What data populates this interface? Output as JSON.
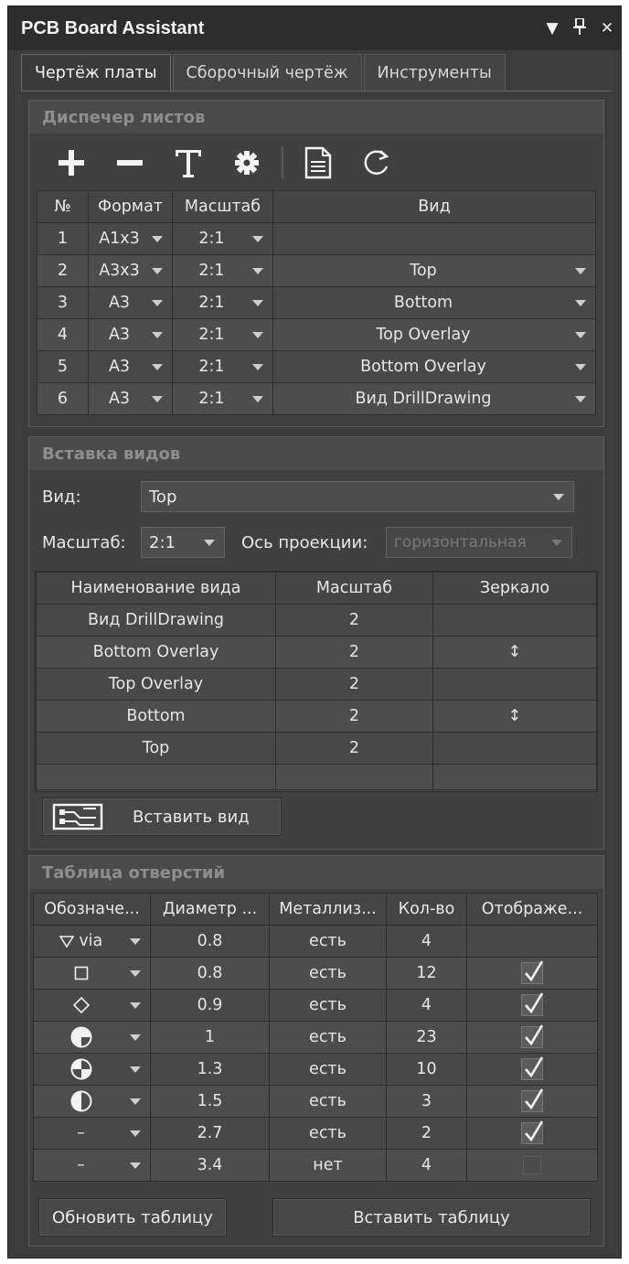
{
  "window": {
    "title": "PCB Board Assistant"
  },
  "tabs": [
    {
      "label": "Чертёж платы",
      "active": true
    },
    {
      "label": "Сборочный чертёж",
      "active": false
    },
    {
      "label": "Инструменты",
      "active": false
    }
  ],
  "sheet_manager": {
    "title": "Диспечер листов",
    "toolbar": [
      "add-icon",
      "remove-icon",
      "text-icon",
      "gear-icon",
      "document-icon",
      "refresh-icon"
    ],
    "headers": {
      "num": "№",
      "format": "Формат",
      "scale": "Масштаб",
      "view": "Вид"
    },
    "rows": [
      {
        "num": "1",
        "format": "А1х3",
        "scale": "2:1",
        "view": ""
      },
      {
        "num": "2",
        "format": "А3х3",
        "scale": "2:1",
        "view": "Top"
      },
      {
        "num": "3",
        "format": "А3",
        "scale": "2:1",
        "view": "Bottom"
      },
      {
        "num": "4",
        "format": "А3",
        "scale": "2:1",
        "view": "Top Overlay"
      },
      {
        "num": "5",
        "format": "А3",
        "scale": "2:1",
        "view": "Bottom Overlay"
      },
      {
        "num": "6",
        "format": "А3",
        "scale": "2:1",
        "view": "Вид DrillDrawing"
      }
    ]
  },
  "insert_views": {
    "title": "Вставка видов",
    "view_label": "Вид:",
    "view_value": "Top",
    "scale_label": "Масштаб:",
    "scale_value": "2:1",
    "axis_label": "Ось проекции:",
    "axis_value": "горизонтальная",
    "headers": {
      "name": "Наименование вида",
      "scale": "Масштаб",
      "mirror": "Зеркало"
    },
    "rows": [
      {
        "name": "Вид DrillDrawing",
        "scale": "2",
        "mirror": ""
      },
      {
        "name": "Bottom Overlay",
        "scale": "2",
        "mirror": "↕"
      },
      {
        "name": "Top Overlay",
        "scale": "2",
        "mirror": ""
      },
      {
        "name": "Bottom",
        "scale": "2",
        "mirror": "↕"
      },
      {
        "name": "Top",
        "scale": "2",
        "mirror": ""
      }
    ],
    "insert_button": "Вставить вид"
  },
  "holes_table": {
    "title": "Таблица отверстий",
    "headers": {
      "symbol": "Обозначе...",
      "diameter": "Диаметр ...",
      "plating": "Металлиз...",
      "count": "Кол-во",
      "display": "Отображе..."
    },
    "rows": [
      {
        "symbol": "via",
        "symbol_icon": "triangle-down-icon",
        "diameter": "0.8",
        "plating": "есть",
        "count": "4",
        "display": "none"
      },
      {
        "symbol": "",
        "symbol_icon": "square-icon",
        "diameter": "0.8",
        "plating": "есть",
        "count": "12",
        "display": "checked"
      },
      {
        "symbol": "",
        "symbol_icon": "diamond-icon",
        "diameter": "0.9",
        "plating": "есть",
        "count": "4",
        "display": "checked"
      },
      {
        "symbol": "",
        "symbol_icon": "quarter-circle-icon",
        "diameter": "1",
        "plating": "есть",
        "count": "23",
        "display": "checked"
      },
      {
        "symbol": "",
        "symbol_icon": "cross-circle-icon",
        "diameter": "1.3",
        "plating": "есть",
        "count": "10",
        "display": "checked"
      },
      {
        "symbol": "",
        "symbol_icon": "half-circle-icon",
        "diameter": "1.5",
        "plating": "есть",
        "count": "3",
        "display": "checked"
      },
      {
        "symbol": "–",
        "symbol_icon": "dash-icon",
        "diameter": "2.7",
        "plating": "есть",
        "count": "2",
        "display": "checked"
      },
      {
        "symbol": "–",
        "symbol_icon": "dash-icon",
        "diameter": "3.4",
        "plating": "нет",
        "count": "4",
        "display": "unchecked"
      }
    ],
    "update_button": "Обновить таблицу",
    "insert_button": "Вставить таблицу"
  }
}
